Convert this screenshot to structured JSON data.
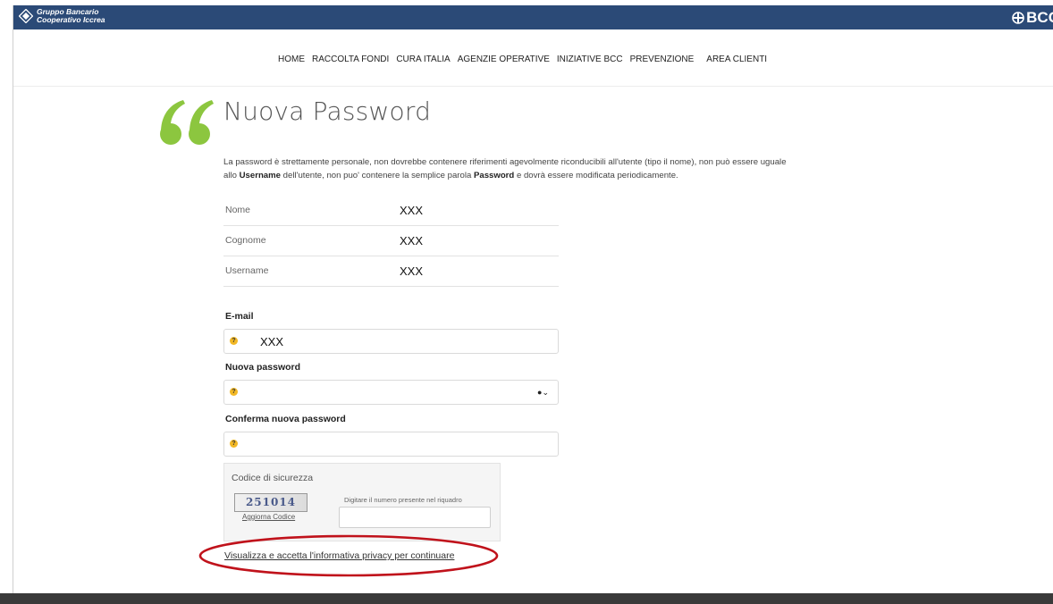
{
  "header": {
    "brand_line1": "Gruppo Bancario",
    "brand_line2": "Cooperativo Iccrea",
    "right_logo": "BCC"
  },
  "nav": {
    "items": [
      "HOME",
      "RACCOLTA FONDI",
      "CURA ITALIA",
      "AGENZIE OPERATIVE",
      "INIZIATIVE BCC",
      "PREVENZIONE",
      "AREA CLIENTI"
    ]
  },
  "page": {
    "title": "Nuova Password",
    "intro_1": "La password è strettamente personale, non dovrebbe contenere riferimenti agevolmente riconducibili all'utente (tipo il nome), non può essere uguale",
    "intro_2a": "allo ",
    "intro_2b": "Username",
    "intro_2c": " dell'utente, non puo' contenere la semplice parola ",
    "intro_2d": "Password",
    "intro_2e": " e dovrà essere modificata periodicamente."
  },
  "info": {
    "nome_label": "Nome",
    "nome_value": "XXX",
    "cognome_label": "Cognome",
    "cognome_value": "XXX",
    "username_label": "Username",
    "username_value": "XXX"
  },
  "form": {
    "email_label": "E-mail",
    "email_value": "XXX",
    "new_password_label": "Nuova password",
    "confirm_password_label": "Conferma nuova password"
  },
  "captcha": {
    "title": "Codice di sicurezza",
    "code": "251014",
    "refresh": "Aggiorna Codice",
    "hint": "Digitare il numero presente nel riquadro"
  },
  "privacy": {
    "link": "Visualizza e accetta l'informativa privacy per continuare"
  },
  "colors": {
    "topbar": "#2b4a77",
    "accent_green": "#8cc63f",
    "annotation_red": "#c0121b"
  }
}
